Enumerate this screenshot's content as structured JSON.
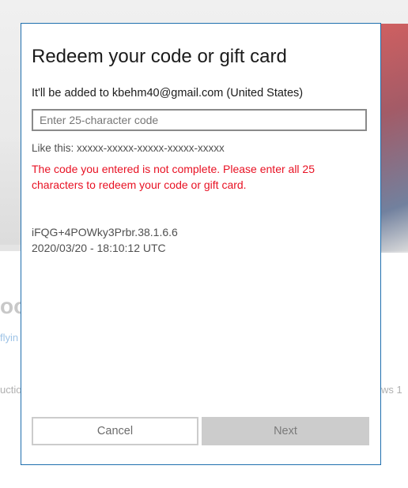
{
  "background": {
    "big_text": "oo",
    "link_text": "flyin",
    "left_word": "uction",
    "right_word": "ws 1"
  },
  "dialog": {
    "title": "Redeem your code or gift card",
    "subtitle": "It'll be added to kbehm40@gmail.com (United States)",
    "input": {
      "placeholder": "Enter 25-character code",
      "value": ""
    },
    "hint": "Like this: xxxxx-xxxxx-xxxxx-xxxxx-xxxxx",
    "error": "The code you entered is not complete. Please enter all 25 characters to redeem your code or gift card.",
    "diagnostics": {
      "correlation_id": "iFQG+4POWky3Prbr.38.1.6.6",
      "timestamp": "2020/03/20 - 18:10:12 UTC"
    },
    "buttons": {
      "cancel": "Cancel",
      "next": "Next"
    },
    "colors": {
      "border": "#1f6fae",
      "error": "#e81123",
      "disabled_button": "#cccccc"
    }
  }
}
